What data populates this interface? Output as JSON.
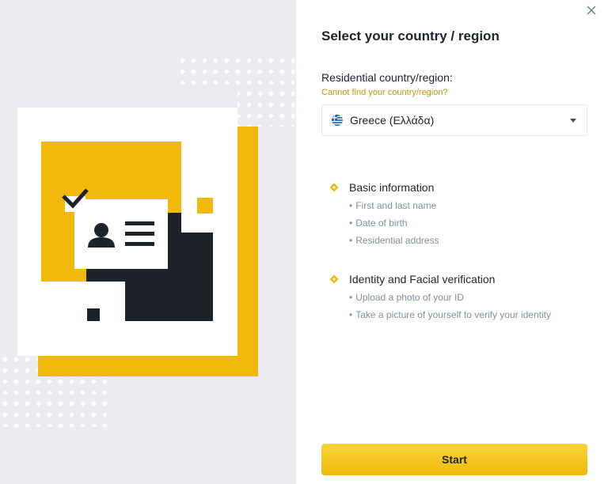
{
  "title": "Select your country / region",
  "residential_label": "Residential country/region:",
  "help_link": "Cannot find your country/region?",
  "country_select": {
    "value": "Greece (Ελλάδα)",
    "flag_icon": "greece-flag-icon"
  },
  "sections": [
    {
      "title": "Basic information",
      "items": [
        "First and last name",
        "Date of birth",
        "Residential address"
      ]
    },
    {
      "title": "Identity and Facial verification",
      "items": [
        "Upload a photo of your ID",
        "Take a picture of yourself to verify your identity"
      ]
    }
  ],
  "start_label": "Start",
  "colors": {
    "brand_yellow": "#F0B90B",
    "dark": "#1E2329",
    "muted_text": "#848E9C",
    "link": "#C99400",
    "left_bg": "#EAECEF"
  }
}
